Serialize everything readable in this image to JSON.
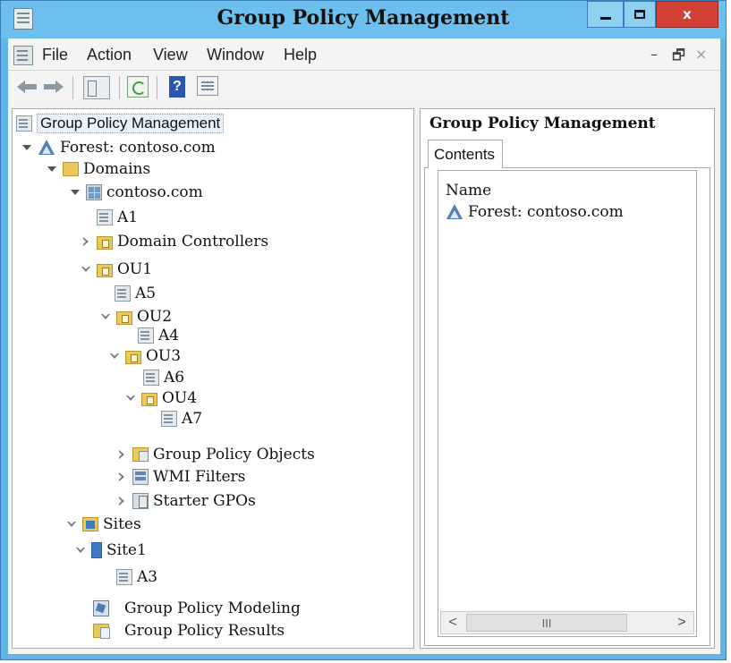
{
  "window": {
    "title": "Group Policy Management",
    "controls": {
      "minimize": "–",
      "maximize": "□",
      "close": "x"
    }
  },
  "menu": {
    "items": [
      "File",
      "Action",
      "View",
      "Window",
      "Help"
    ],
    "mdi_controls": {
      "minimize": "–",
      "restore": "🗗",
      "close": "×"
    }
  },
  "toolbar": {
    "buttons": [
      "back-icon",
      "forward-icon",
      "show-hide-console-tree-icon",
      "refresh-icon",
      "help-icon",
      "properties-icon"
    ],
    "help_glyph": "?"
  },
  "tree": {
    "root": "Group Policy Management",
    "forest": "Forest: contoso.com",
    "domains": "Domains",
    "domain": "contoso.com",
    "a1": "A1",
    "domain_controllers": "Domain Controllers",
    "ou1": "OU1",
    "a5": "A5",
    "ou2": "OU2",
    "a4": "A4",
    "ou3": "OU3",
    "a6": "A6",
    "ou4": "OU4",
    "a7": "A7",
    "gpo_objects": "Group Policy Objects",
    "wmi_filters": "WMI Filters",
    "starter_gpos": "Starter GPOs",
    "sites": "Sites",
    "site1": "Site1",
    "a3": "A3",
    "modeling": "Group Policy Modeling",
    "results": "Group Policy Results"
  },
  "right_pane": {
    "title": "Group Policy Management",
    "tab": "Contents",
    "column_header": "Name",
    "rows": [
      "Forest: contoso.com"
    ],
    "scroll": {
      "left": "<",
      "thumb": "III",
      "right": ">"
    }
  },
  "colors": {
    "title_bar": "#6dc0ee",
    "close_button": "#d14135",
    "folder": "#e9c85e",
    "selection": "#e8f1fa"
  }
}
